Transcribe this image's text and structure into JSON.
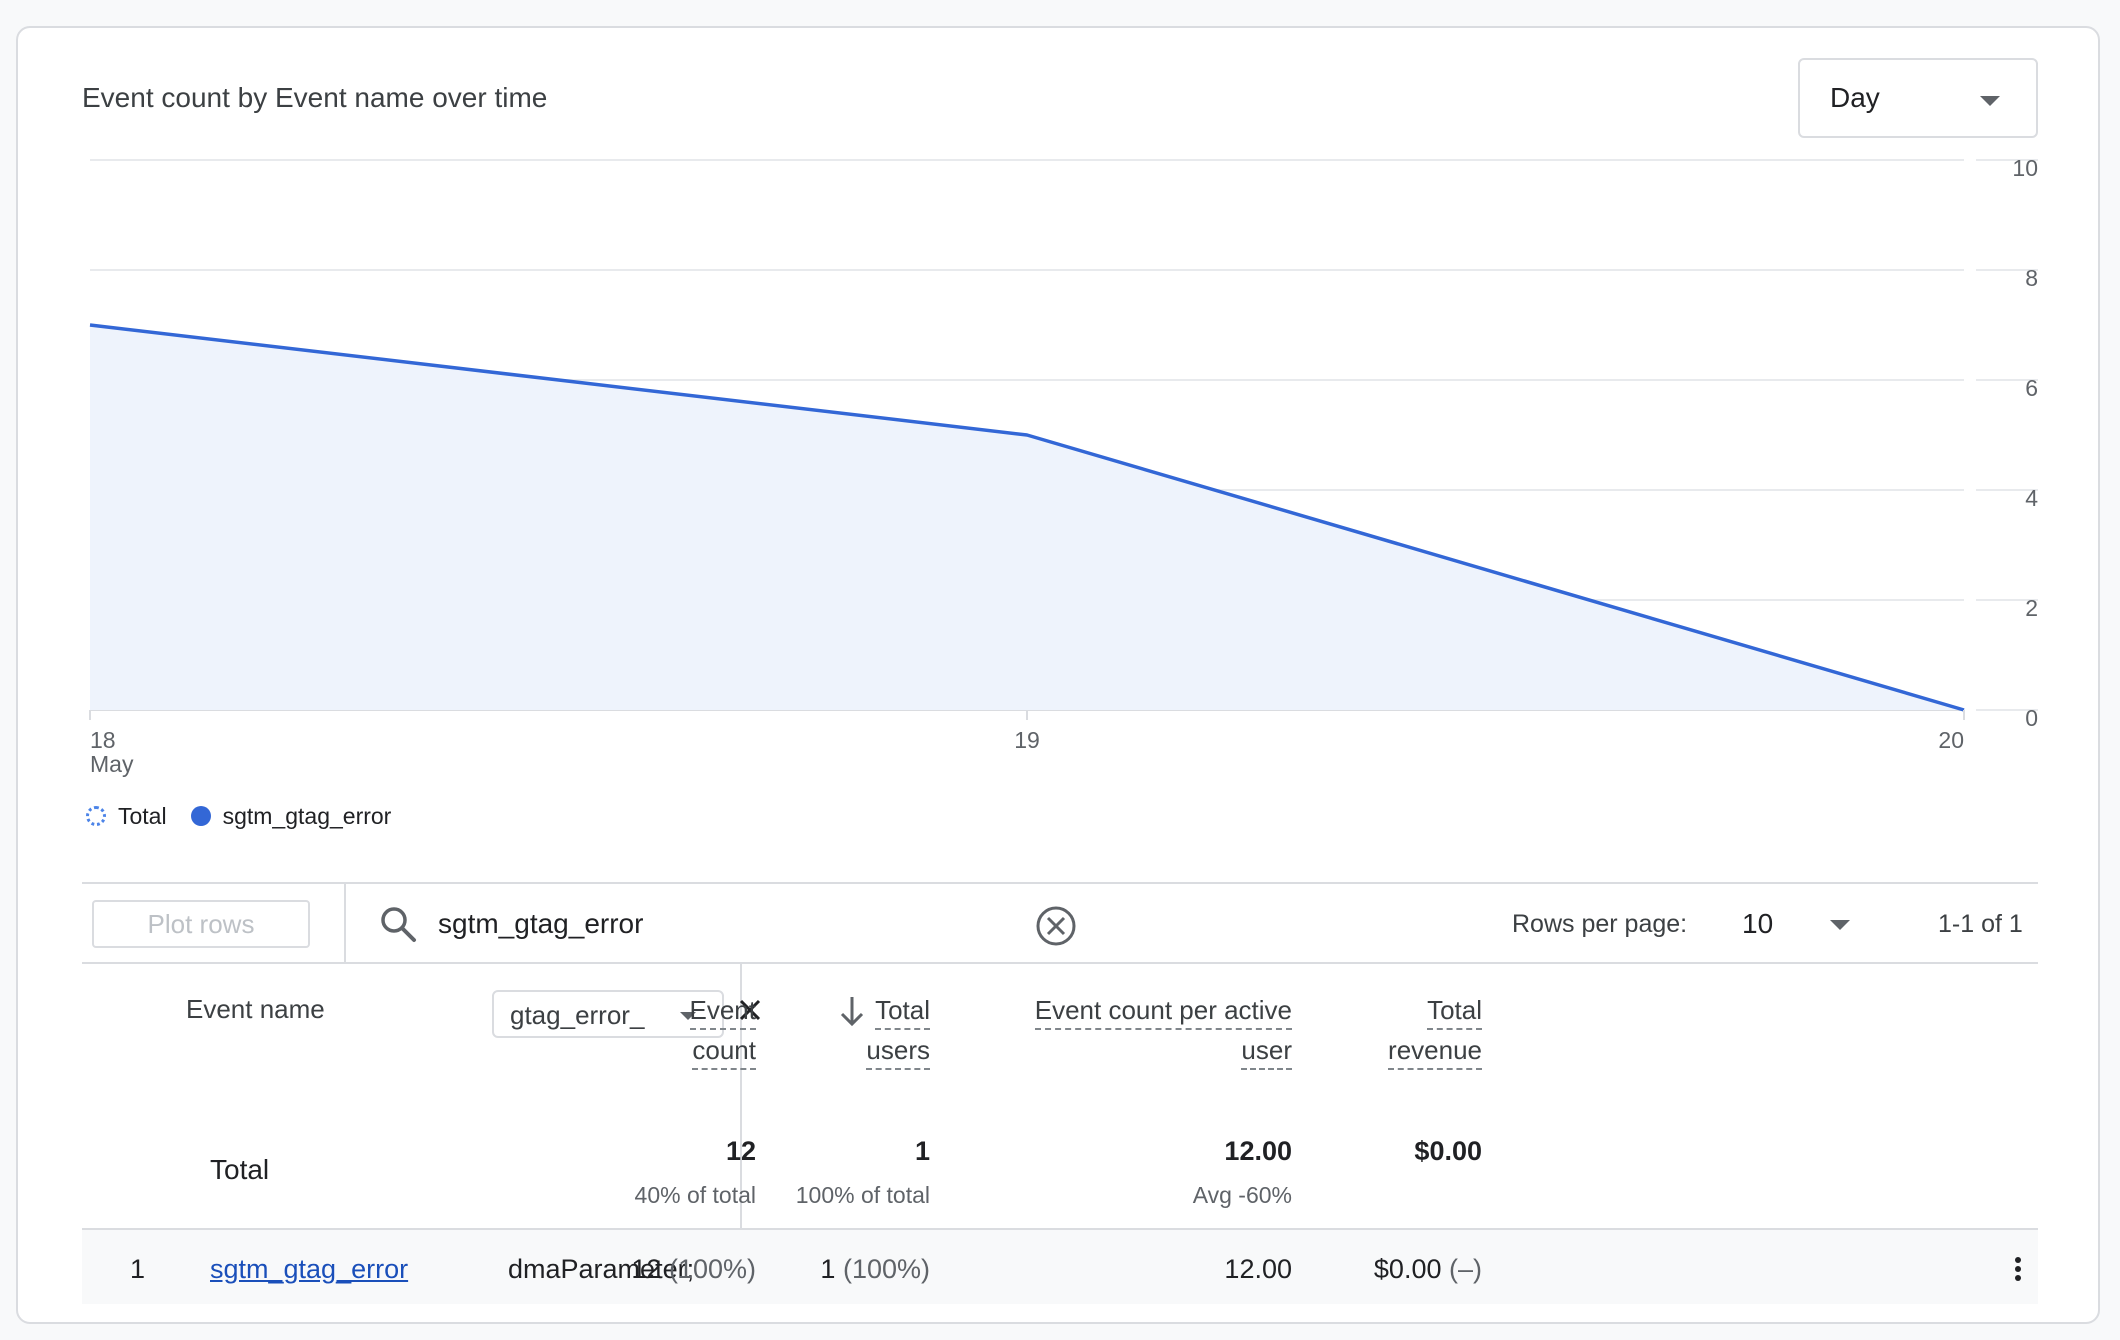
{
  "card": {
    "title": "Event count by Event name over time",
    "granularity": "Day"
  },
  "chart_data": {
    "type": "area",
    "title": "Event count by Event name over time",
    "x": [
      "18\nMay",
      "19",
      "20"
    ],
    "x_tick_labels": [
      "18",
      "19",
      "20"
    ],
    "x_tick_sublabel": "May",
    "series": [
      {
        "name": "sgtm_gtag_error",
        "values": [
          7,
          5,
          0
        ]
      }
    ],
    "ylim": [
      0,
      10
    ],
    "y_ticks": [
      "0",
      "2",
      "4",
      "6",
      "8",
      "10"
    ],
    "y_axis_position": "right",
    "grid": true,
    "legend_position": "bottom-left",
    "colors": {
      "line": "#3367d6",
      "fill": "#eef3fc",
      "grid": "#e8eaed"
    }
  },
  "legend": [
    {
      "label": "Total",
      "style": "dotted"
    },
    {
      "label": "sgtm_gtag_error",
      "style": "solid"
    }
  ],
  "toolbar": {
    "plot_rows": "Plot rows",
    "search_value": "sgtm_gtag_error",
    "rows_per_page_label": "Rows per page:",
    "rows_per_page_value": "10",
    "page_info": "1-1 of 1"
  },
  "table": {
    "dimension_header": "Event name",
    "filter_value": "gtag_error_",
    "headers": {
      "event_count": [
        "Event",
        "count"
      ],
      "total_users": [
        "Total",
        "users"
      ],
      "per_user": [
        "Event count per active",
        "user"
      ],
      "revenue": [
        "Total",
        "revenue"
      ]
    },
    "total": {
      "label": "Total",
      "event_count": "12",
      "event_count_sub": "40% of total",
      "total_users": "1",
      "total_users_sub": "100% of total",
      "per_user": "12.00",
      "per_user_sub": "Avg -60%",
      "revenue": "$0.00"
    },
    "rows": [
      {
        "index": "1",
        "event_name": "sgtm_gtag_error",
        "parameter": "dmaParameter;",
        "event_count": "12",
        "event_count_pct": "(100%)",
        "total_users": "1",
        "total_users_pct": "(100%)",
        "per_user": "12.00",
        "revenue": "$0.00",
        "revenue_pct": "(–)"
      }
    ]
  }
}
